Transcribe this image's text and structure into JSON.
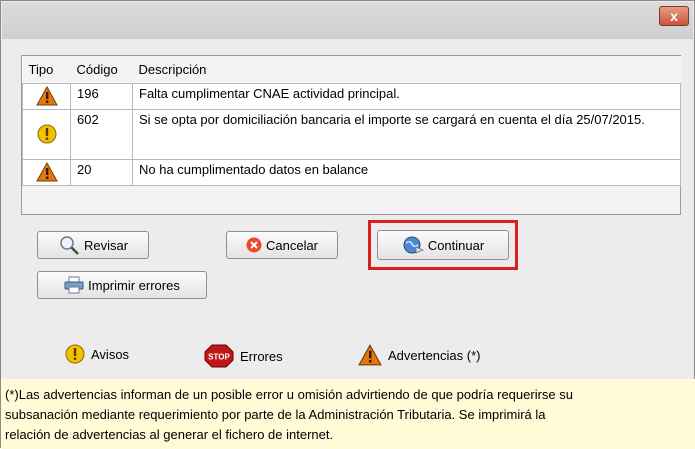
{
  "dialog": {
    "close_label": "x"
  },
  "table": {
    "headers": [
      "Tipo",
      "Código",
      "Descripción"
    ],
    "rows": [
      {
        "tipo_icon": "warning-triangle-icon",
        "codigo": "196",
        "descripcion": "Falta cumplimentar CNAE actividad principal."
      },
      {
        "tipo_icon": "exclamation-icon",
        "codigo": "602",
        "descripcion": "Si se opta por domiciliación bancaria el importe se cargará en cuenta el día 25/07/2015."
      },
      {
        "tipo_icon": "warning-triangle-icon",
        "codigo": "20",
        "descripcion": "No ha cumplimentado datos en balance"
      }
    ]
  },
  "buttons": {
    "revisar": "Revisar",
    "cancelar": "Cancelar",
    "continuar": "Continuar",
    "imprimir": "Imprimir errores"
  },
  "legend": {
    "avisos": "Avisos",
    "errores": "Errores",
    "stop_text": "STOP",
    "advertencias": "Advertencias (*)"
  },
  "note": {
    "line1": "(*)Las advertencias informan de un posible error u omisión advirtiendo de que podría requerirse su",
    "line2": "subsanación mediante requerimiento por parte de la Administración Tributaria. Se imprimirá la",
    "line3": "relación de advertencias al generar el fichero de internet."
  },
  "colors": {
    "highlight": "#d92020",
    "note_background": "#fffbd6",
    "warning": "#e07a10",
    "exclamation": "#f2c200",
    "stop": "#c0181a"
  }
}
